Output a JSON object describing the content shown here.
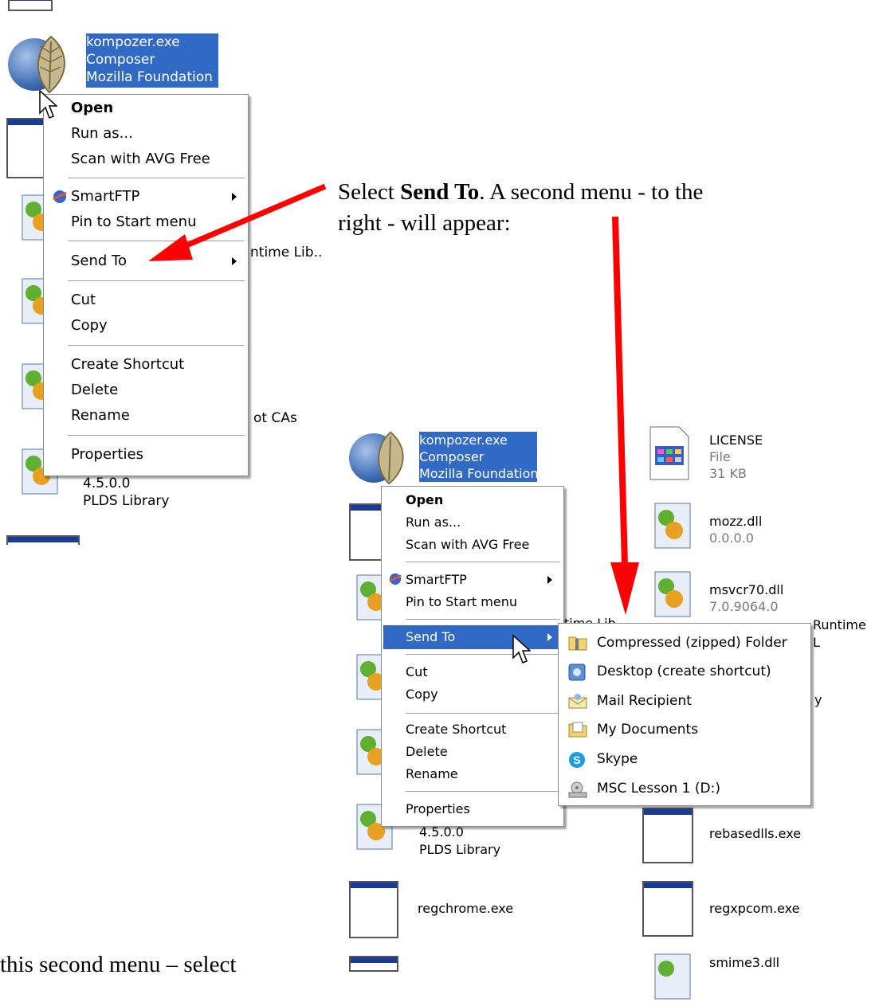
{
  "note": {
    "line1_pre": "Select ",
    "line1_bold": "Send To",
    "line1_post": ".  A second menu - to the",
    "line2": "right - will appear:",
    "bottom": "this second menu – select"
  },
  "left": {
    "file": {
      "name": "kompozer.exe",
      "desc": "Composer",
      "company": "Mozilla Foundation"
    },
    "menu": {
      "open": "Open",
      "run_as": "Run as...",
      "scan": "Scan with AVG Free",
      "smartftp": "SmartFTP",
      "pin": "Pin to Start menu",
      "send_to": "Send To",
      "cut": "Cut",
      "copy": "Copy",
      "create_shortcut": "Create Shortcut",
      "delete": "Delete",
      "rename": "Rename",
      "properties": "Properties"
    },
    "behind": {
      "runtime_fragment": "ntime Lib..",
      "ca_fragment": "ot CAs",
      "version": "4.5.0.0",
      "library": "PLDS Library"
    }
  },
  "right": {
    "file": {
      "name": "kompozer.exe",
      "desc": "Composer",
      "company": "Mozilla Foundation"
    },
    "menu": {
      "open": "Open",
      "run_as": "Run as...",
      "scan": "Scan with AVG Free",
      "smartftp": "SmartFTP",
      "pin": "Pin to Start menu",
      "send_to": "Send To",
      "cut": "Cut",
      "copy": "Copy",
      "create_shortcut": "Create Shortcut",
      "delete": "Delete",
      "rename": "Rename",
      "properties": "Properties"
    },
    "sendto_menu": [
      {
        "label": "Compressed (zipped) Folder",
        "icon": "zip-folder-icon"
      },
      {
        "label": "Desktop (create shortcut)",
        "icon": "desktop-icon"
      },
      {
        "label": "Mail Recipient",
        "icon": "mail-icon"
      },
      {
        "label": "My Documents",
        "icon": "my-documents-icon"
      },
      {
        "label": "Skype",
        "icon": "skype-icon"
      },
      {
        "label": "MSC Lesson 1 (D:)",
        "icon": "drive-icon"
      }
    ],
    "files": {
      "license": {
        "name": "LICENSE",
        "type": "File",
        "size": "31 KB"
      },
      "mozz": {
        "name": "mozz.dll",
        "version": "0.0.0.0"
      },
      "msvcr70": {
        "name": "msvcr70.dll",
        "version": "7.0.9064.0",
        "desc_fragment": "Runtime L"
      },
      "rebasedlls": {
        "name": "rebasedlls.exe"
      },
      "regxpcom": {
        "name": "regxpcom.exe"
      },
      "regchrome": {
        "name": "regchrome.exe"
      },
      "smime3": {
        "name": "smime3.dll"
      },
      "plds": {
        "version": "4.5.0.0",
        "library": "PLDS Library"
      },
      "runtime_fragment": "time Lib",
      "y_fragment": "y"
    }
  },
  "colors": {
    "selection": "#316ac5",
    "arrow": "#ff0000"
  }
}
